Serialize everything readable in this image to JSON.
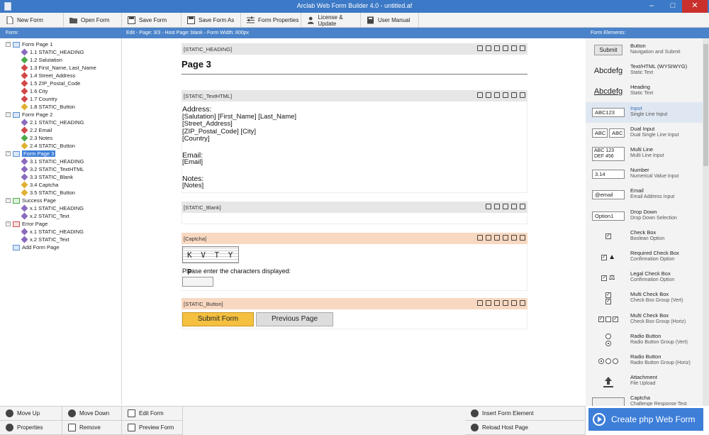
{
  "window": {
    "title": "Arclab Web Form Builder 4.0 - untitled.af",
    "min": "–",
    "max": "□",
    "close": "✕"
  },
  "toolbar": [
    {
      "label": "New Form"
    },
    {
      "label": "Open Form"
    },
    {
      "label": "Save Form"
    },
    {
      "label": "Save Form As"
    },
    {
      "label": "Form Properties"
    },
    {
      "label": "License & Update"
    },
    {
      "label": "User Manual"
    }
  ],
  "strip": {
    "left": "Form:",
    "center": "Edit - Page: 3/3 - Host Page: blank - Form Width: 800px",
    "right": "Form Elements:"
  },
  "tree": [
    {
      "label": "Form Page 1",
      "kind": "page"
    },
    {
      "label": "1.1 STATIC_HEADING",
      "kind": "item",
      "color": "purple"
    },
    {
      "label": "1.2 Salutation",
      "kind": "item",
      "color": "green"
    },
    {
      "label": "1.3 First_Name, Last_Name",
      "kind": "item",
      "color": "red"
    },
    {
      "label": "1.4 Street_Address",
      "kind": "item",
      "color": "red"
    },
    {
      "label": "1.5 ZIP_Postal_Code",
      "kind": "item",
      "color": "red"
    },
    {
      "label": "1.6 City",
      "kind": "item",
      "color": "red"
    },
    {
      "label": "1.7 Country",
      "kind": "item",
      "color": "red"
    },
    {
      "label": "1.8 STATIC_Button",
      "kind": "item",
      "color": "gold"
    },
    {
      "label": "Form Page 2",
      "kind": "page"
    },
    {
      "label": "2.1 STATIC_HEADING",
      "kind": "item",
      "color": "purple"
    },
    {
      "label": "2.2 Email",
      "kind": "item",
      "color": "red"
    },
    {
      "label": "2.3 Notes",
      "kind": "item",
      "color": "green"
    },
    {
      "label": "2.4 STATIC_Button",
      "kind": "item",
      "color": "gold"
    },
    {
      "label": "Form Page 3",
      "kind": "page",
      "selected": true
    },
    {
      "label": "3.1 STATIC_HEADING",
      "kind": "item",
      "color": "purple"
    },
    {
      "label": "3.2 STATIC_TextHTML",
      "kind": "item",
      "color": "purple"
    },
    {
      "label": "3.3 STATIC_Blank",
      "kind": "item",
      "color": "purple"
    },
    {
      "label": "3.4 Captcha",
      "kind": "item",
      "color": "gold"
    },
    {
      "label": "3.5 STATIC_Button",
      "kind": "item",
      "color": "gold"
    },
    {
      "label": "Success Page",
      "kind": "page",
      "tone": "green"
    },
    {
      "label": "x.1 STATIC_HEADING",
      "kind": "item",
      "color": "purple"
    },
    {
      "label": "x.2 STATIC_Text",
      "kind": "item",
      "color": "purple"
    },
    {
      "label": "Error Page",
      "kind": "page",
      "tone": "red"
    },
    {
      "label": "x.1 STATIC_HEADING",
      "kind": "item",
      "color": "purple"
    },
    {
      "label": "x.2 STATIC_Text",
      "kind": "item",
      "color": "purple"
    },
    {
      "label": "Add Form Page",
      "kind": "add"
    }
  ],
  "canvas": {
    "heading_tag": "[STATIC_HEADING]",
    "heading_text": "Page 3",
    "texthtml_tag": "[STATIC_TextHTML]",
    "address_title": "Address:",
    "address_lines": [
      "[Salutation] [First_Name] [Last_Name]",
      "[Street_Address]",
      "[ZIP_Postal_Code] [City]",
      "[Country]"
    ],
    "email_title": "Email:",
    "email_line": "[Email]",
    "notes_title": "Notes:",
    "notes_line": "[Notes]",
    "blank_tag": "[STATIC_Blank]",
    "captcha_tag": "[Captcha]",
    "captcha_code": "K V T Y P",
    "captcha_prompt": "Please enter the characters displayed:",
    "button_tag": "[STATIC_Button]",
    "submit_label": "Submit Form",
    "prev_label": "Previous Page"
  },
  "palette": [
    {
      "name": "Button",
      "desc": "Navigation and Submit",
      "preview": "Submit"
    },
    {
      "name": "Text/HTML (WYSIWYG)",
      "desc": "Static Text",
      "preview": "Abcdefg"
    },
    {
      "name": "Heading",
      "desc": "Static Text",
      "preview": "Abcdefg"
    },
    {
      "name": "Input",
      "desc": "Single Line Input",
      "preview": "ABC123",
      "highlight": true
    },
    {
      "name": "Dual Input",
      "desc": "Dual Single Line Input",
      "preview": "ABC",
      "preview2": "ABC"
    },
    {
      "name": "Multi Line",
      "desc": "Multi Line Input",
      "preview": "ABC 123",
      "preview2": "DEF 456"
    },
    {
      "name": "Number",
      "desc": "Numerical Value Input",
      "preview": "3.14"
    },
    {
      "name": "Email",
      "desc": "Email Address Input",
      "preview": "@email"
    },
    {
      "name": "Drop Down",
      "desc": "Drop Down Selection",
      "preview": "Option1"
    },
    {
      "name": "Check Box",
      "desc": "Boolean Option"
    },
    {
      "name": "Required Check Box",
      "desc": "Confirmation Option"
    },
    {
      "name": "Legal Check Box",
      "desc": "Confirmation Option"
    },
    {
      "name": "Multi Check Box",
      "desc": "Check Box Group (Vert)"
    },
    {
      "name": "Multi Check Box",
      "desc": "Check Box Group (Horiz)"
    },
    {
      "name": "Radio Button",
      "desc": "Radio Button Group (Vert)"
    },
    {
      "name": "Radio Button",
      "desc": "Radio Button Group (Horiz)"
    },
    {
      "name": "Attachment",
      "desc": "File Upload"
    },
    {
      "name": "Captcha",
      "desc": "Challenge Response Test"
    }
  ],
  "bottom": {
    "move_up": "Move Up",
    "move_down": "Move Down",
    "edit_form": "Edit Form",
    "insert": "Insert Form Element",
    "properties": "Properties",
    "remove": "Remove",
    "preview": "Preview Form",
    "reload": "Reload Host Page",
    "create": "Create php Web Form"
  }
}
